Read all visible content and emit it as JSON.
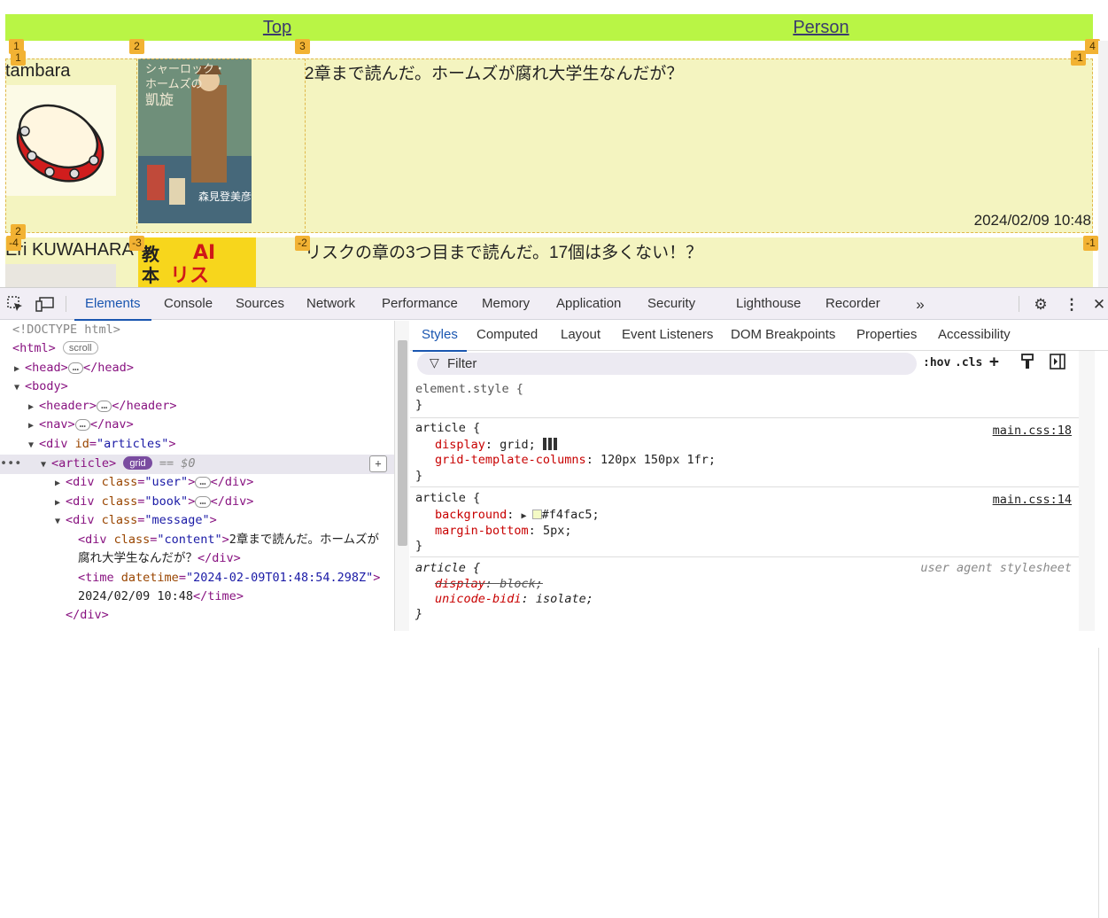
{
  "page": {
    "nav": {
      "links": [
        "Top",
        "Person"
      ],
      "bg": "#b9f545"
    },
    "articles": [
      {
        "user": "tambara",
        "message": "2章まで読んだ。ホームズが腐れ大学生なんだが？",
        "time": "2024/02/09 10:48",
        "book_title_lines": [
          "シャーロック・",
          "ホームズの",
          "凱旋"
        ],
        "book_author": "森見登美彦"
      },
      {
        "user": "Eri KUWAHARA",
        "message": "リスクの章の3つ目まで読んだ。17個は多くない！？",
        "book_title_lines": [
          "AI",
          "リスク",
          "教本"
        ]
      }
    ],
    "article_bg": "#f4f4c0",
    "grid_badges": {
      "row1": [
        "1",
        "2",
        "3",
        "4"
      ],
      "row1b": [
        "1",
        "-1"
      ],
      "row2": [
        "2"
      ],
      "row2b": [
        "-4",
        "-3",
        "-2",
        "-1"
      ]
    }
  },
  "devtools": {
    "tabs": [
      "Elements",
      "Console",
      "Sources",
      "Network",
      "Performance",
      "Memory",
      "Application",
      "Security",
      "Lighthouse",
      "Recorder"
    ],
    "active_tab": "Elements",
    "more_icon": "chevron-double-right-icon",
    "dom": {
      "doctype": "<!DOCTYPE html>",
      "html_open": "<html>",
      "scroll_pill": "scroll",
      "head": "head",
      "body": "body",
      "header": "header",
      "nav": "nav",
      "div_articles_attr": "id",
      "div_articles_val": "\"articles\"",
      "article": "article",
      "grid_pill": "grid",
      "eq_dollar": "== $0",
      "user_div_val": "\"user\"",
      "book_div_val": "\"book\"",
      "message_div_val": "\"message\"",
      "content_div_val": "\"content\"",
      "content_text_1": "2章まで読んだ。ホームズが",
      "content_text_2": "腐れ大学生なんだが？",
      "time_attr": "datetime",
      "time_val": "\"2024-02-09T01:48:54.298Z\"",
      "time_text": "2024/02/09 10:48",
      "class_attr": "class",
      "ellipsis": "…"
    },
    "styles_tabs": [
      "Styles",
      "Computed",
      "Layout",
      "Event Listeners",
      "DOM Breakpoints",
      "Properties",
      "Accessibility"
    ],
    "active_styles_tab": "Styles",
    "filter_placeholder": "Filter",
    "hov": ":hov",
    "cls": ".cls",
    "rules": [
      {
        "selector": "element.style {",
        "close": "}",
        "props": []
      },
      {
        "selector": "article {",
        "source": "main.css:18",
        "close": "}",
        "props": [
          {
            "name": "display",
            "value": "grid;"
          },
          {
            "name": "grid-template-columns",
            "value": "120px 150px 1fr;"
          }
        ]
      },
      {
        "selector": "article {",
        "source": "main.css:14",
        "close": "}",
        "props": [
          {
            "name": "background",
            "value": "#f4fac5;"
          },
          {
            "name": "margin-bottom",
            "value": "5px;"
          }
        ]
      },
      {
        "selector": "article {",
        "source": "user agent stylesheet",
        "close": "}",
        "props": [
          {
            "name": "display",
            "value": "block;"
          },
          {
            "name": "unicode-bidi",
            "value": "isolate;"
          }
        ]
      }
    ],
    "swatch_color": "#f4fac5"
  }
}
